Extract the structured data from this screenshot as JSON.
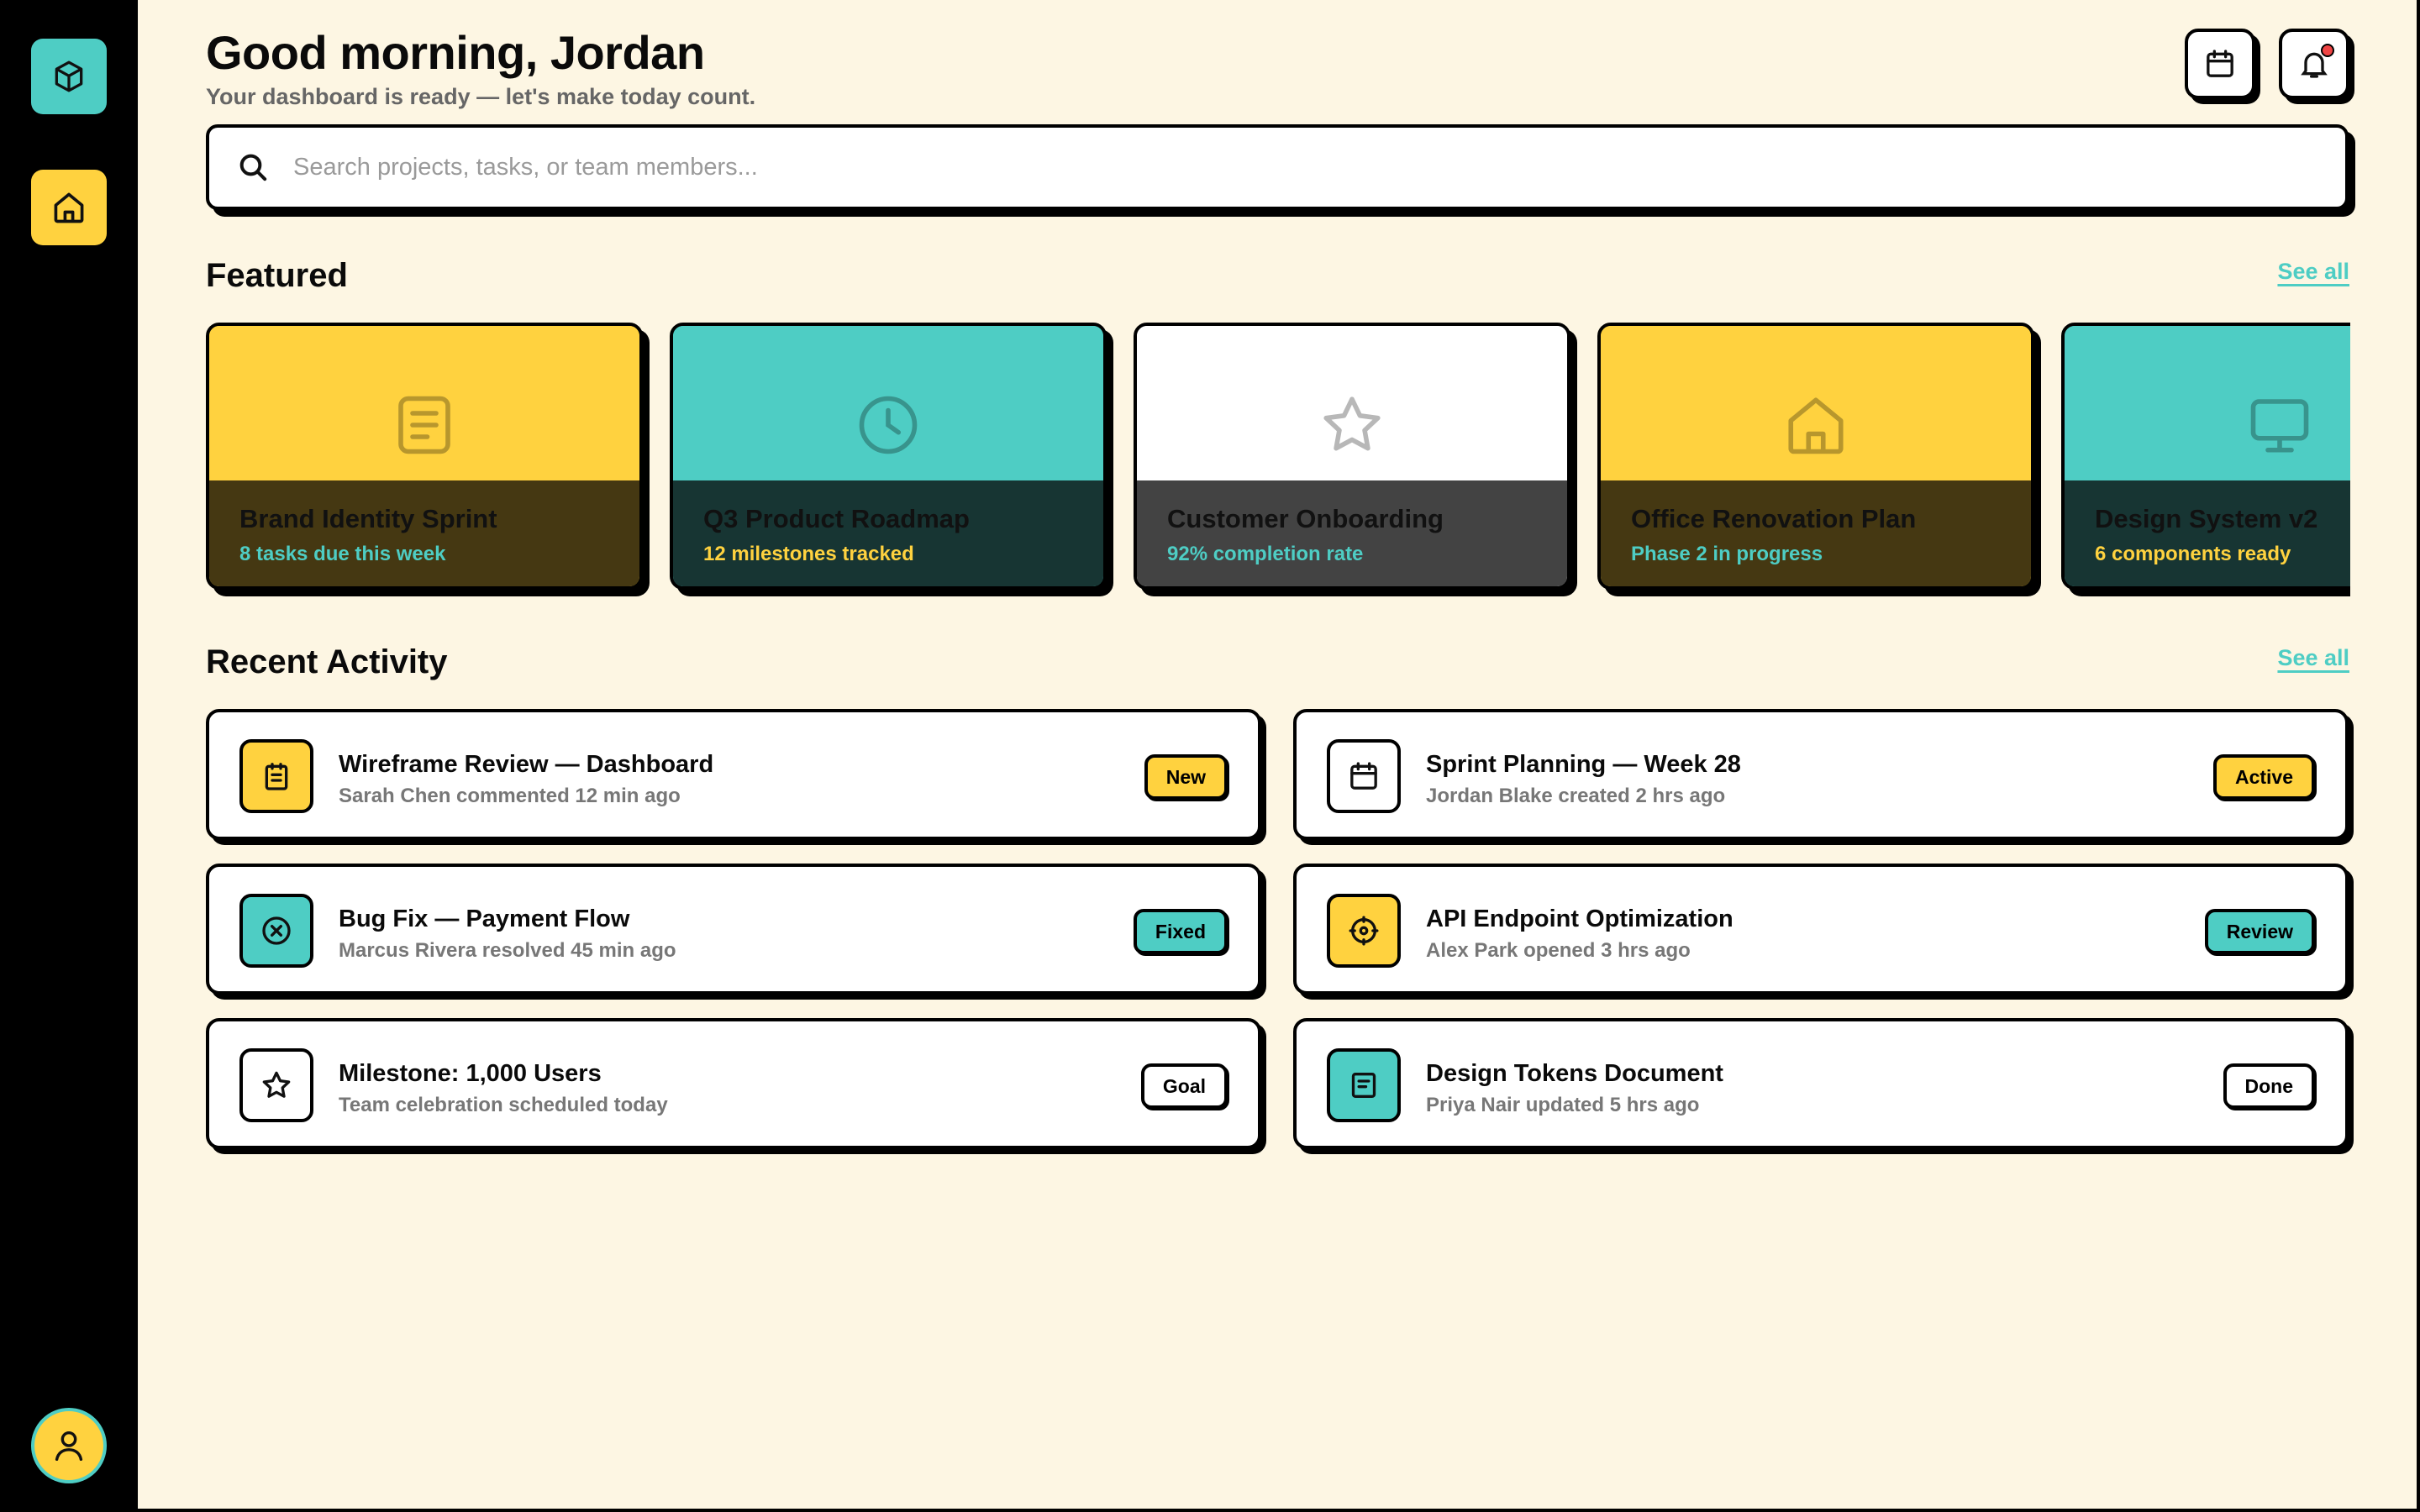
{
  "header": {
    "greeting": "Good morning, Jordan",
    "subtitle": "Your dashboard is ready — let's make today count."
  },
  "search": {
    "placeholder": "Search projects, tasks, or team members..."
  },
  "sidebar": {
    "logo_icon": "cube-icon",
    "home_icon": "home-icon",
    "avatar_icon": "user-icon"
  },
  "top_actions": {
    "calendar_icon": "calendar-icon",
    "notifications_icon": "bell-icon",
    "has_notification": true
  },
  "featured": {
    "title": "Featured",
    "see_all": "See all",
    "cards": [
      {
        "title": "Brand Identity Sprint",
        "subtitle": "8 tasks due this week",
        "icon": "document-icon",
        "bg": "#ffd23f",
        "overlay": "#453812",
        "sub_color": "#4ecdc4"
      },
      {
        "title": "Q3 Product Roadmap",
        "subtitle": "12 milestones tracked",
        "icon": "clock-icon",
        "bg": "#4ecdc4",
        "overlay": "#173533",
        "sub_color": "#ffd23f"
      },
      {
        "title": "Customer Onboarding",
        "subtitle": "92% completion rate",
        "icon": "star-icon",
        "bg": "#ffffff",
        "overlay": "#434343",
        "sub_color": "#4ecdc4"
      },
      {
        "title": "Office Renovation Plan",
        "subtitle": "Phase 2 in progress",
        "icon": "home-icon",
        "bg": "#ffd23f",
        "overlay": "#453812",
        "sub_color": "#4ecdc4"
      },
      {
        "title": "Design System v2",
        "subtitle": "6 components ready",
        "icon": "monitor-icon",
        "bg": "#4ecdc4",
        "overlay": "#173533",
        "sub_color": "#ffd23f"
      }
    ]
  },
  "recent": {
    "title": "Recent Activity",
    "see_all": "See all",
    "items": [
      {
        "title": "Wireframe Review — Dashboard",
        "meta": "Sarah Chen commented 12 min ago",
        "badge": "New",
        "badge_color": "yellow",
        "icon": "clipboard-icon",
        "icon_bg": "yellow"
      },
      {
        "title": "Sprint Planning — Week 28",
        "meta": "Jordan Blake created 2 hrs ago",
        "badge": "Active",
        "badge_color": "yellow",
        "icon": "calendar-icon",
        "icon_bg": "white"
      },
      {
        "title": "Bug Fix — Payment Flow",
        "meta": "Marcus Rivera resolved 45 min ago",
        "badge": "Fixed",
        "badge_color": "teal",
        "icon": "close-circle-icon",
        "icon_bg": "teal"
      },
      {
        "title": "API Endpoint Optimization",
        "meta": "Alex Park opened 3 hrs ago",
        "badge": "Review",
        "badge_color": "teal",
        "icon": "target-icon",
        "icon_bg": "yellow"
      },
      {
        "title": "Milestone: 1,000 Users",
        "meta": "Team celebration scheduled today",
        "badge": "Goal",
        "badge_color": "white",
        "icon": "star-icon",
        "icon_bg": "white"
      },
      {
        "title": "Design Tokens Document",
        "meta": "Priya Nair updated 5 hrs ago",
        "badge": "Done",
        "badge_color": "white",
        "icon": "document-icon",
        "icon_bg": "teal"
      }
    ]
  },
  "colors": {
    "yellow": "#ffd23f",
    "teal": "#4ecdc4",
    "background": "#fdf6e3",
    "ink": "#000000"
  }
}
